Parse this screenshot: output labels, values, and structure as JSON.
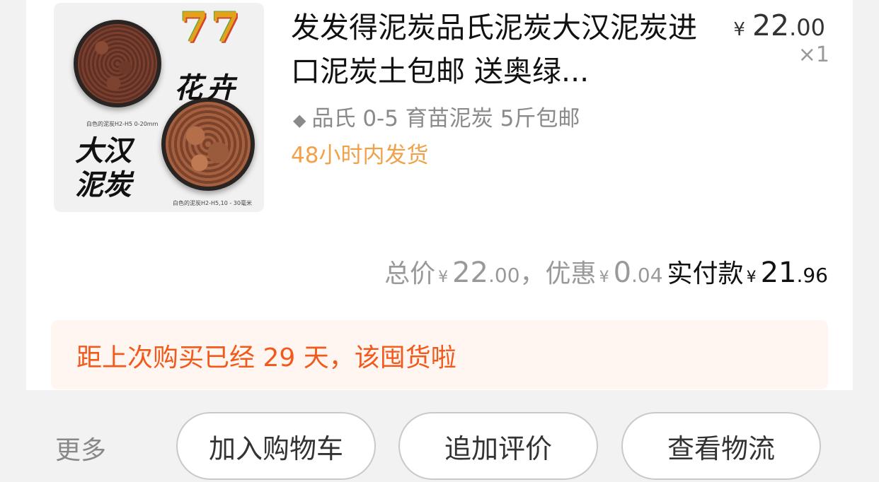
{
  "product": {
    "image": {
      "logo_text": "77",
      "brand_line1": "花卉",
      "brand_line2": "大汉泥炭",
      "caption1": "白色的泥炭H2-H5 0-20mm",
      "caption2": "白色的泥炭H2-H5,10 - 30毫米"
    },
    "title": "发发得泥炭品氏泥炭大汉泥炭进口泥炭土包邮 送奥绿...",
    "unit_price": {
      "currency": "¥",
      "integer": "22",
      "decimal": ".00"
    },
    "quantity": "×1",
    "sku": {
      "marker": "◆",
      "text": "品氏 0-5 育苗泥炭 5斤包邮"
    },
    "shipping": "48小时内发货"
  },
  "totals": {
    "total_label": "总价",
    "total_currency": "¥",
    "total_int": "22",
    "total_dec": ".00",
    "separator": "，",
    "discount_label": "优惠",
    "discount_currency": "¥",
    "discount_int": "0",
    "discount_dec": ".04",
    "paid_label": "实付款",
    "paid_currency": "¥",
    "paid_int": "21",
    "paid_dec": ".96"
  },
  "notice": {
    "text": "距上次购买已经 29 天，该囤货啦",
    "color": "#f25a1c",
    "background": "#fff5f1"
  },
  "actions": {
    "more_label": "更多",
    "buttons": [
      {
        "label": "加入购物车"
      },
      {
        "label": "追加评价"
      },
      {
        "label": "查看物流"
      }
    ]
  },
  "colors": {
    "shipping": "#f0a14a",
    "text_primary": "#111111",
    "text_secondary": "#999999"
  }
}
